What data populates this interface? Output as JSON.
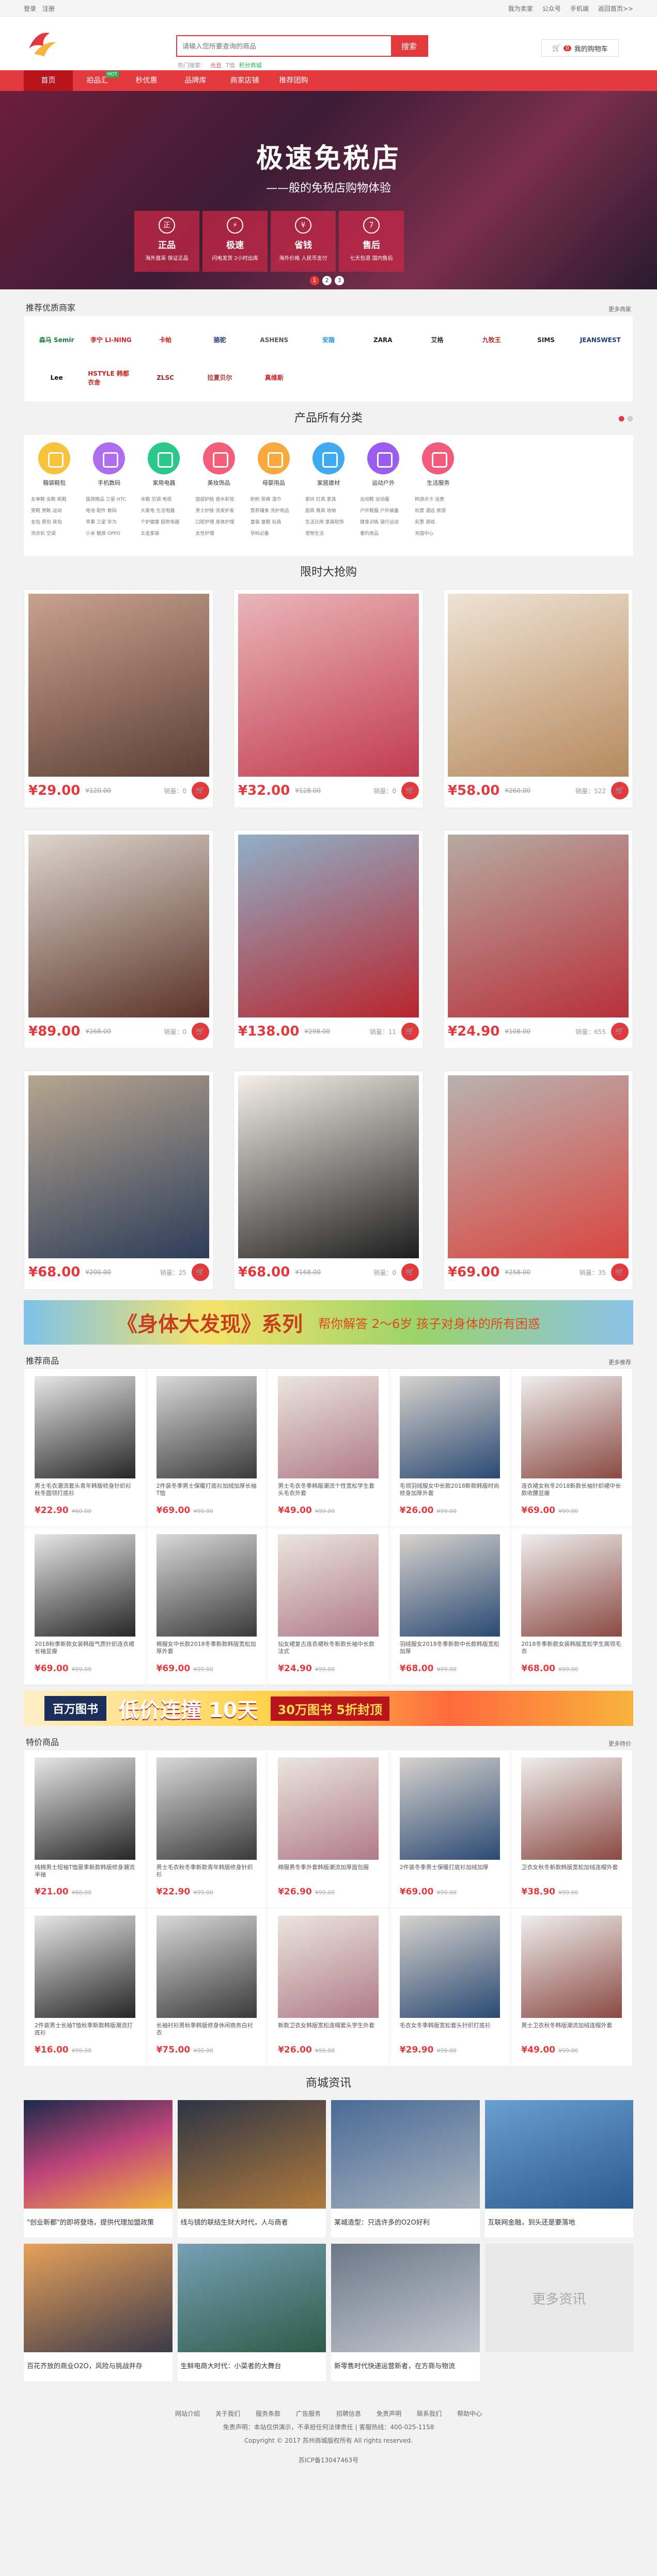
{
  "topbar": {
    "login": "登录",
    "register": "注册",
    "links": [
      "我为卖家",
      "公众号",
      "手机端",
      "返回首页>>"
    ]
  },
  "search": {
    "placeholder": "请输入您所要查询的商品",
    "button": "搜索",
    "hot_label": "热门搜索：",
    "hot": [
      "元旦",
      "T恤",
      "积分商城"
    ]
  },
  "cart": {
    "label": "我的购物车",
    "count": "0"
  },
  "nav": {
    "items": [
      "首页",
      "拍品汇",
      "秒优惠",
      "品牌库",
      "商家店铺",
      "推荐团购"
    ],
    "badge": "HOT"
  },
  "banner": {
    "title": "极速免税店",
    "subtitle": "——般的免税店购物体验",
    "feats": [
      {
        "icon": "正",
        "h": "正品",
        "s": "海外直采 保证正品"
      },
      {
        "icon": "⚡",
        "h": "极速",
        "s": "闪电发货 2小时出库"
      },
      {
        "icon": "¥",
        "h": "省钱",
        "s": "海外价格 人民币支付"
      },
      {
        "icon": "7",
        "h": "售后",
        "s": "七天包退 国内售后"
      }
    ],
    "dots": [
      "1",
      "2",
      "3"
    ]
  },
  "brands": {
    "title": "推荐优质商家",
    "more": "更多商家",
    "items": [
      "森马 Semir",
      "李宁 LI-NING",
      "卡帕",
      "骆驼",
      "ASHENS",
      "安踏",
      "ZARA",
      "艾格",
      "九牧王",
      "SIMS",
      "JEANSWEST",
      "Lee",
      "HSTYLE 韩都衣舍",
      "ZLSC",
      "拉夏贝尔",
      "真维斯"
    ]
  },
  "categories": {
    "title": "产品所有分类",
    "items": [
      {
        "name": "箱袋鞋包",
        "color": "#f7c23c",
        "sub": [
          "女单鞋 女靴 帆鞋",
          "男鞋 男靴 运动",
          "女包 男包 背包",
          "洗衣机 空调"
        ]
      },
      {
        "name": "手机数码",
        "color": "#ae6cf1",
        "sub": [
          "国货精品 三星 HTC",
          "电池 配件 数码",
          "苹果 三星 华为",
          "小米 魅族 OPPO"
        ]
      },
      {
        "name": "家用电器",
        "color": "#2bc88c",
        "sub": [
          "冰箱 空调 电视",
          "大家电 生活电器",
          "个护健康 厨房电器",
          "五金家装"
        ]
      },
      {
        "name": "美妆饰品",
        "color": "#f45e7a",
        "sub": [
          "面部护肤 香水彩妆",
          "男士护肤 洗发护发",
          "口腔护理 身体护理",
          "女性护理"
        ]
      },
      {
        "name": "母婴用品",
        "color": "#f9a83c",
        "sub": [
          "奶粉 尿裤 湿巾",
          "营养辅食 洗护用品",
          "童装 童鞋 玩具",
          "孕妈必备"
        ]
      },
      {
        "name": "家居建材",
        "color": "#3fa9f2",
        "sub": [
          "家纺 灯具 家具",
          "厨具 餐具 收纳",
          "生活日用 家装软饰",
          "宠物生活"
        ]
      },
      {
        "name": "运动户外",
        "color": "#9b5cf0",
        "sub": [
          "运动鞋 运动服",
          "户外鞋服 户外装备",
          "健身训练 骑行运动",
          "垂钓用品"
        ]
      },
      {
        "name": "生活服务",
        "color": "#f25b7b",
        "sub": [
          "网游点卡 话费",
          "机票 酒店 旅游",
          "彩票 游戏",
          "充值中心"
        ]
      }
    ]
  },
  "flash": {
    "title": "限时大抢购",
    "sold_label": "销量：",
    "items": [
      {
        "price": "¥29.00",
        "orig": "¥120.00",
        "sold": "0"
      },
      {
        "price": "¥32.00",
        "orig": "¥128.00",
        "sold": "0"
      },
      {
        "price": "¥58.00",
        "orig": "¥260.00",
        "sold": "522"
      },
      {
        "price": "¥89.00",
        "orig": "¥268.00",
        "sold": "0"
      },
      {
        "price": "¥138.00",
        "orig": "¥298.00",
        "sold": "11"
      },
      {
        "price": "¥24.90",
        "orig": "¥108.00",
        "sold": "655"
      },
      {
        "price": "¥68.00",
        "orig": "¥200.00",
        "sold": "25"
      },
      {
        "price": "¥68.00",
        "orig": "¥168.00",
        "sold": "0"
      },
      {
        "price": "¥69.00",
        "orig": "¥258.00",
        "sold": "35"
      }
    ]
  },
  "ad1": {
    "main": "《身体大发现》系列",
    "side": "帮你解答 2～6岁 孩子对身体的所有困惑"
  },
  "rec": {
    "title": "推荐商品",
    "more": "更多推荐",
    "items": [
      {
        "desc": "男士毛衣潮流套头青年韩版修身针织衫秋冬圆领打底衫",
        "price": "¥22.90",
        "orig": "¥60.00"
      },
      {
        "desc": "2件装冬季男士保暖打底衫加绒加厚长袖T恤",
        "price": "¥69.00",
        "orig": "¥99.00"
      },
      {
        "desc": "男士毛衣冬季韩版潮流个性宽松学生套头毛衣外套",
        "price": "¥49.00",
        "orig": "¥99.00"
      },
      {
        "desc": "毛领羽绒服女中长款2018新款韩版时尚修身加厚外套",
        "price": "¥26.00",
        "orig": "¥99.00"
      },
      {
        "desc": "连衣裙女秋冬2018新款长袖针织裙中长款收腰显瘦",
        "price": "¥69.00",
        "orig": "¥99.00"
      },
      {
        "desc": "2018秋季新款女装韩版气质针织连衣裙长袖显瘦",
        "price": "¥69.00",
        "orig": "¥99.00"
      },
      {
        "desc": "棉服女中长款2018冬季新款韩版宽松加厚外套",
        "price": "¥69.00",
        "orig": "¥99.00"
      },
      {
        "desc": "仙女裙复古连衣裙秋冬新款长袖中长款法式",
        "price": "¥24.90",
        "orig": "¥99.00"
      },
      {
        "desc": "羽绒服女2018冬季新款中长款韩版宽松加厚",
        "price": "¥68.00",
        "orig": "¥99.00"
      },
      {
        "desc": "2018冬季新款女装韩版宽松学生高领毛衣",
        "price": "¥68.00",
        "orig": "¥99.00"
      }
    ]
  },
  "ad2": {
    "tag": "百万图书",
    "main": "低价连撞 10天",
    "side": "30万图书 5折封顶"
  },
  "special": {
    "title": "特价商品",
    "more": "更多特价",
    "items": [
      {
        "desc": "纯棉男士短袖T恤夏季新款韩版修身潮流半袖",
        "price": "¥21.00",
        "orig": "¥60.00"
      },
      {
        "desc": "男士毛衣秋冬季新款青年韩版修身针织衫",
        "price": "¥22.90",
        "orig": "¥99.00"
      },
      {
        "desc": "棉服男冬季外套韩版潮流加厚面包服",
        "price": "¥26.90",
        "orig": "¥99.00"
      },
      {
        "desc": "2件装冬季男士保暖打底衫加绒加厚",
        "price": "¥69.00",
        "orig": "¥99.00"
      },
      {
        "desc": "卫衣女秋冬新款韩版宽松加绒连帽外套",
        "price": "¥38.90",
        "orig": "¥99.00"
      },
      {
        "desc": "2件装男士长袖T恤秋季新款韩版潮流打底衫",
        "price": "¥16.00",
        "orig": "¥99.00"
      },
      {
        "desc": "长袖衬衫男秋季韩版修身休闲商务白衬衣",
        "price": "¥75.00",
        "orig": "¥99.00"
      },
      {
        "desc": "新款卫衣女韩版宽松连帽套头学生外套",
        "price": "¥26.00",
        "orig": "¥99.00"
      },
      {
        "desc": "毛衣女冬季韩版宽松套头针织打底衫",
        "price": "¥29.90",
        "orig": "¥99.00"
      },
      {
        "desc": "男士卫衣秋冬韩版潮流加绒连帽外套",
        "price": "¥49.00",
        "orig": "¥99.00"
      }
    ]
  },
  "news": {
    "title": "商城资讯",
    "items": [
      "\"创业新都\"的即将登场，提供代理加盟政策",
      "线与镜的联结生财大时代，人与商者",
      "某城造型：只选许多的O2O好利",
      "互联网金融，到头还是要落地",
      "百花齐放的商业O2O，风险与挑战并存",
      "生鲜电商大时代：小菜者的大舞台",
      "新零售时代快递运营新者，在方商与物流"
    ],
    "more": "更多资讯"
  },
  "footer": {
    "links": [
      "网站介绍",
      "关于我们",
      "服务条款",
      "广告服务",
      "招聘信息",
      "免责声明",
      "联系我们",
      "帮助中心"
    ],
    "line1": "免责声明：本站仅供演示，不承担任何法律责任 | 客服热线：400-025-1158",
    "line2": "Copyright © 2017 苏州商城版权所有 All rights reserved.",
    "icp": "苏ICP备13047463号"
  }
}
